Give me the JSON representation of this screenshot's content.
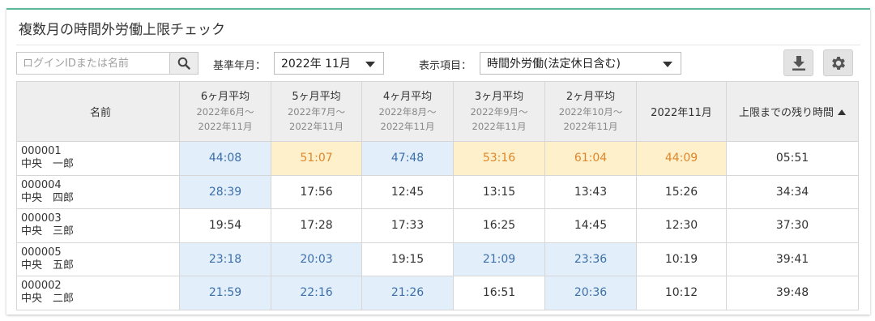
{
  "panel": {
    "title": "複数月の時間外労働上限チェック"
  },
  "toolbar": {
    "search_placeholder": "ログインIDまたは名前",
    "base_month_label": "基準年月：",
    "base_month_value": "2022年 11月",
    "display_item_label": "表示項目：",
    "display_item_value": "時間外労働(法定休日含む)",
    "download_icon": "download-icon",
    "settings_icon": "gear-icon"
  },
  "table": {
    "name_header": "名前",
    "columns": [
      {
        "title": "6ヶ月平均",
        "from": "2022年6月～",
        "to": "2022年11月"
      },
      {
        "title": "5ヶ月平均",
        "from": "2022年7月～",
        "to": "2022年11月"
      },
      {
        "title": "4ヶ月平均",
        "from": "2022年8月～",
        "to": "2022年11月"
      },
      {
        "title": "3ヶ月平均",
        "from": "2022年9月～",
        "to": "2022年11月"
      },
      {
        "title": "2ヶ月平均",
        "from": "2022年10月～",
        "to": "2022年11月"
      }
    ],
    "month_header": "2022年11月",
    "remain_header": "上限までの残り時間",
    "rows": [
      {
        "id": "000001",
        "name": "中央　一郎",
        "cells": [
          "44:08",
          "51:07",
          "47:48",
          "53:16",
          "61:04",
          "44:09"
        ],
        "remain": "05:51",
        "status": [
          "blue",
          "yellow",
          "blue",
          "yellow",
          "yellow",
          "yellow"
        ]
      },
      {
        "id": "000004",
        "name": "中央　四郎",
        "cells": [
          "28:39",
          "17:56",
          "12:45",
          "13:15",
          "13:43",
          "15:26"
        ],
        "remain": "34:34",
        "status": [
          "blue",
          "",
          "",
          "",
          "",
          ""
        ]
      },
      {
        "id": "000003",
        "name": "中央　三郎",
        "cells": [
          "19:54",
          "17:28",
          "17:33",
          "16:25",
          "14:45",
          "12:30"
        ],
        "remain": "37:30",
        "status": [
          "",
          "",
          "",
          "",
          "",
          ""
        ]
      },
      {
        "id": "000005",
        "name": "中央　五郎",
        "cells": [
          "23:18",
          "20:03",
          "19:15",
          "21:09",
          "23:36",
          "10:19"
        ],
        "remain": "39:41",
        "status": [
          "blue",
          "blue",
          "",
          "blue",
          "blue",
          ""
        ]
      },
      {
        "id": "000002",
        "name": "中央　二郎",
        "cells": [
          "21:59",
          "22:16",
          "21:26",
          "16:51",
          "20:36",
          "10:12"
        ],
        "remain": "39:48",
        "status": [
          "blue",
          "blue",
          "blue",
          "",
          "blue",
          ""
        ]
      }
    ]
  },
  "colors": {
    "accent": "#5cb89a",
    "warning_bg": "#fdf0cb",
    "warning_text": "#e0862a",
    "notice_bg": "#e2effb",
    "notice_text": "#3d6fa8"
  }
}
